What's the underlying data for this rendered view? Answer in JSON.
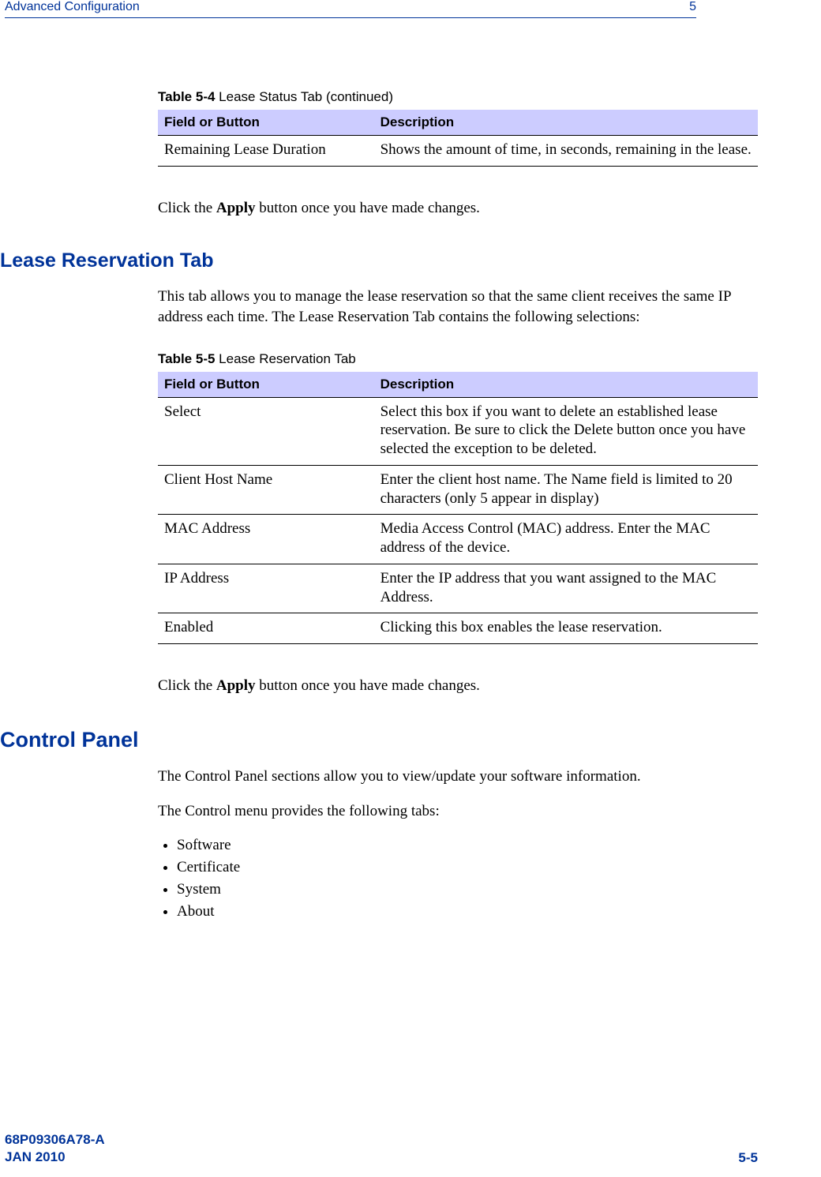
{
  "header": {
    "left": "Advanced Configuration",
    "right": "5"
  },
  "table54": {
    "caption_prefix": "Table 5-4",
    "caption_rest": " Lease Status Tab (continued)",
    "col1_header": "Field or Button",
    "col2_header": "Description",
    "rows": [
      {
        "field": "Remaining Lease Duration",
        "desc": "Shows the amount of time, in seconds, remaining in the lease."
      }
    ]
  },
  "para_apply1_pre": "Click the ",
  "para_apply1_bold": "Apply",
  "para_apply1_post": " button once you have made changes.",
  "section_lease": "Lease Reservation Tab",
  "lease_intro": "This tab allows you to manage the lease reservation so that the same client receives the same IP address each time. The Lease Reservation Tab contains the following selections:",
  "table55": {
    "caption_prefix": "Table 5-5",
    "caption_rest": " Lease Reservation Tab",
    "col1_header": "Field or Button",
    "col2_header": "Description",
    "rows": [
      {
        "field": "Select",
        "desc": "Select this box if you want to delete an established lease reservation. Be sure to click the Delete button once you have selected the exception to be deleted."
      },
      {
        "field": "Client Host Name",
        "desc": "Enter the client host name. The Name field is limited to 20 characters (only 5 appear in display)"
      },
      {
        "field": "MAC Address",
        "desc": "Media Access Control (MAC) address. Enter the MAC address of the device."
      },
      {
        "field": "IP Address",
        "desc": "Enter the IP address that you want assigned to the MAC Address."
      },
      {
        "field": "Enabled",
        "desc": "Clicking this box enables the lease reservation."
      }
    ]
  },
  "para_apply2_pre": "Click the ",
  "para_apply2_bold": "Apply",
  "para_apply2_post": " button once you have made changes.",
  "section_control": "Control Panel",
  "control_intro1": "The Control Panel sections allow you to view/update your software information.",
  "control_intro2": "The Control menu provides the following tabs:",
  "control_items": [
    "Software",
    "Certificate",
    "System",
    "About"
  ],
  "footer": {
    "doc": "68P09306A78-A",
    "date": "JAN 2010",
    "page": "5-5"
  }
}
